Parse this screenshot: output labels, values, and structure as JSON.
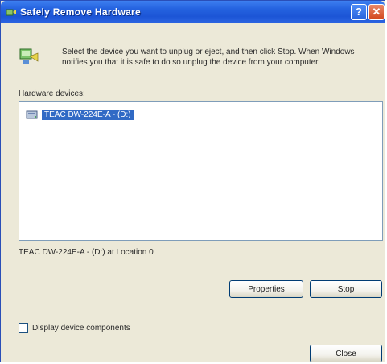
{
  "dialog": {
    "title": "Safely Remove Hardware",
    "help_label": "?",
    "close_glyph": "✕"
  },
  "instructions": "Select the device you want to unplug or eject, and then click Stop. When Windows notifies you that it is safe to do so unplug the device from your computer.",
  "hardware_devices": {
    "label": "Hardware devices:",
    "items": [
      {
        "label": "TEAC DW-224E-A - (D:)",
        "icon": "drive-icon",
        "selected": true
      }
    ]
  },
  "location_text": "TEAC DW-224E-A - (D:) at Location 0",
  "buttons": {
    "properties": "Properties",
    "stop": "Stop",
    "close": "Close"
  },
  "options": {
    "display_components_label": "Display device components",
    "display_components_checked": false
  },
  "colors": {
    "titlebar": "#2563e0",
    "selection": "#316ac5",
    "dialog_bg": "#ece9d8"
  }
}
